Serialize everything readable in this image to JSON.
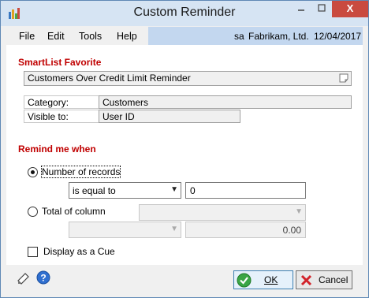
{
  "window": {
    "title": "Custom Reminder",
    "close_glyph": "X"
  },
  "menubar": {
    "items": [
      "File",
      "Edit",
      "Tools",
      "Help"
    ],
    "user": "sa",
    "company": "Fabrikam, Ltd.",
    "date": "12/04/2017"
  },
  "smartlist": {
    "section_title": "SmartList Favorite",
    "favorite": "Customers Over Credit Limit Reminder",
    "category_label": "Category:",
    "category_value": "Customers",
    "visible_label": "Visible to:",
    "visible_value": "User ID"
  },
  "remind": {
    "section_title": "Remind me when",
    "option_records": {
      "label": "Number of records",
      "checked": true
    },
    "operator": "is equal to",
    "value": "0",
    "option_total": {
      "label": "Total of column",
      "checked": false
    },
    "column_select": "",
    "total_operator": "",
    "total_value": "0.00",
    "cue": {
      "label": "Display as a Cue",
      "checked": false
    }
  },
  "buttons": {
    "ok": "OK",
    "cancel": "Cancel"
  },
  "colors": {
    "accent_red": "#c00000",
    "menu_info_bg": "#c3d7ef",
    "titlebar": "#d6e4f3",
    "close": "#c94a3f"
  }
}
